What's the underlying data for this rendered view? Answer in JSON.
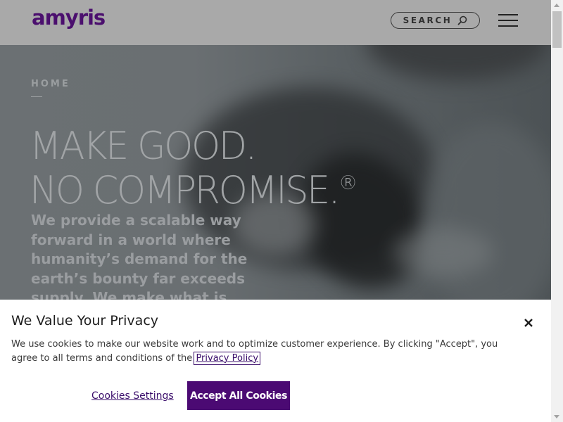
{
  "header": {
    "logo": "amyris",
    "search_label": "SEARCH"
  },
  "hero": {
    "breadcrumb": "HOME",
    "title_line1": "MAKE GOOD.",
    "title_line2": "NO COMPROMISE.",
    "title_mark": "®",
    "text": "We provide a scalable way forward in a world where humanity’s demand for the earth’s bounty far exceeds supply. We make what is"
  },
  "cookie_banner": {
    "title": "We Value Your Privacy",
    "text_before_link": "We use cookies to make our website work and to optimize customer experience.  By clicking \"Accept\", you agree to all terms and conditions of the",
    "privacy_link": "Privacy Policy",
    "settings_label": "Cookies Settings",
    "accept_label": "Accept All Cookies"
  },
  "colors": {
    "brand_purple": "#4b0a73",
    "header_bg": "#a9a9a9",
    "link_purple": "#3a0d6b"
  },
  "icons": {
    "search": "search-icon",
    "menu": "hamburger-menu-icon",
    "close": "close-icon"
  }
}
